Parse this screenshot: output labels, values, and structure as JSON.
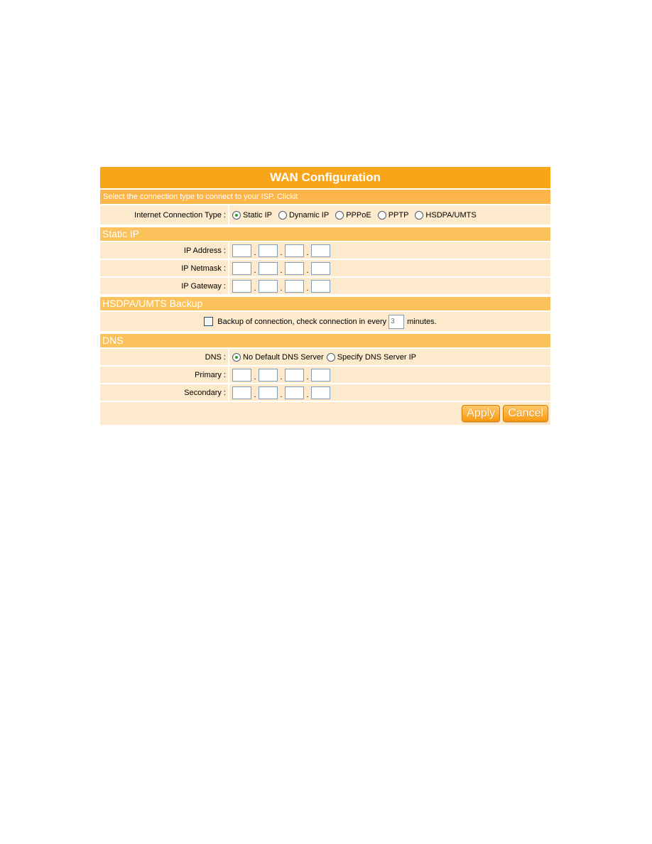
{
  "title": "WAN Configuration",
  "hint": "Select the connection type to connect to your ISP. Clickit",
  "connection": {
    "label": "Internet Connection Type :",
    "options": [
      {
        "label": "Static IP",
        "selected": true
      },
      {
        "label": "Dynamic IP",
        "selected": false
      },
      {
        "label": "PPPoE",
        "selected": false
      },
      {
        "label": "PPTP",
        "selected": false
      },
      {
        "label": "HSDPA/UMTS",
        "selected": false
      }
    ]
  },
  "static_ip": {
    "heading": "Static IP",
    "ip_address_label": "IP Address :",
    "ip_netmask_label": "IP Netmask :",
    "ip_gateway_label": "IP Gateway :",
    "ip_address": [
      "",
      "",
      "",
      ""
    ],
    "ip_netmask": [
      "",
      "",
      "",
      ""
    ],
    "ip_gateway": [
      "",
      "",
      "",
      ""
    ]
  },
  "backup": {
    "heading": "HSDPA/UMTS Backup",
    "checked": false,
    "text_before": "Backup of connection, check connection in every",
    "interval_placeholder": "3",
    "text_after": "minutes."
  },
  "dns": {
    "heading": "DNS",
    "label": "DNS :",
    "options": [
      {
        "label": "No Default DNS Server",
        "selected": true
      },
      {
        "label": "Specify DNS Server IP",
        "selected": false
      }
    ],
    "primary_label": "Primary :",
    "secondary_label": "Secondary :",
    "primary": [
      "",
      "",
      "",
      ""
    ],
    "secondary": [
      "",
      "",
      "",
      ""
    ]
  },
  "buttons": {
    "apply": "Apply",
    "cancel": "Cancel"
  },
  "separator": "."
}
